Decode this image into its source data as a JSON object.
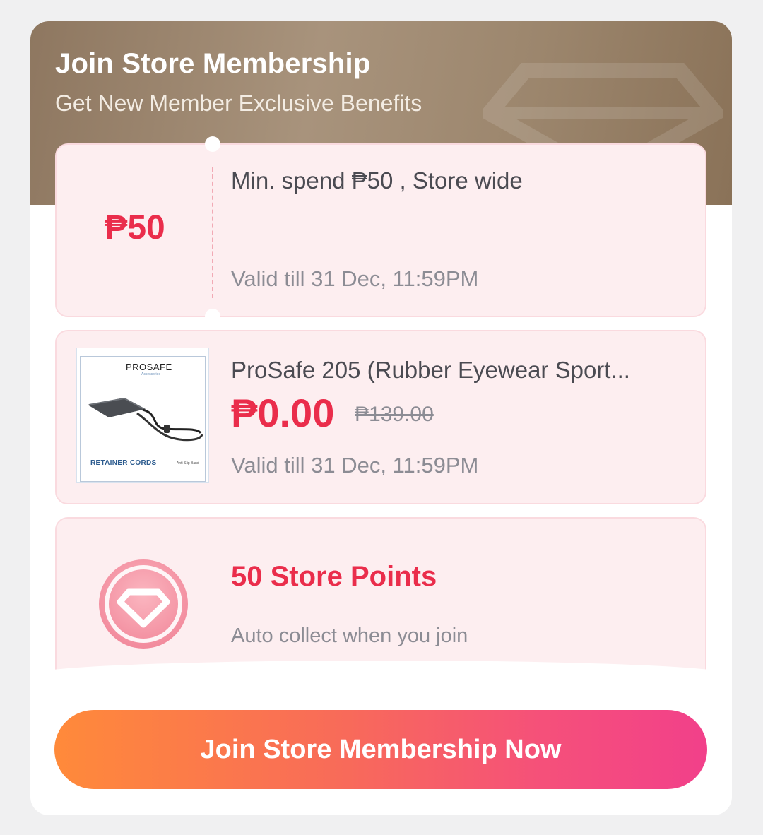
{
  "header": {
    "title": "Join Store Membership",
    "subtitle": "Get New Member Exclusive Benefits"
  },
  "benefits": {
    "coupon": {
      "value": "₱50",
      "title": "Min. spend ₱50 , Store wide",
      "validity": "Valid till 31 Dec, 11:59PM"
    },
    "product": {
      "name": "ProSafe 205 (Rubber Eyewear Sport...",
      "price": "₱0.00",
      "original_price": "₱139.00",
      "validity": "Valid till 31 Dec, 11:59PM",
      "image_labels": {
        "brand": "PROSAFE",
        "brand_sub": "Accessories",
        "caption": "RETAINER CORDS",
        "caption_sub": "Anti-Slip Band"
      }
    },
    "points": {
      "title": "50 Store Points",
      "subtitle": "Auto collect when you join",
      "icon": "diamond-icon"
    }
  },
  "cta": {
    "label": "Join Store Membership Now"
  },
  "colors": {
    "accent": "#ea2d4b",
    "header_brown": "#9c866d",
    "card_pink": "#fdeef0",
    "button_start": "#ff8a3a",
    "button_end": "#f2408a"
  }
}
